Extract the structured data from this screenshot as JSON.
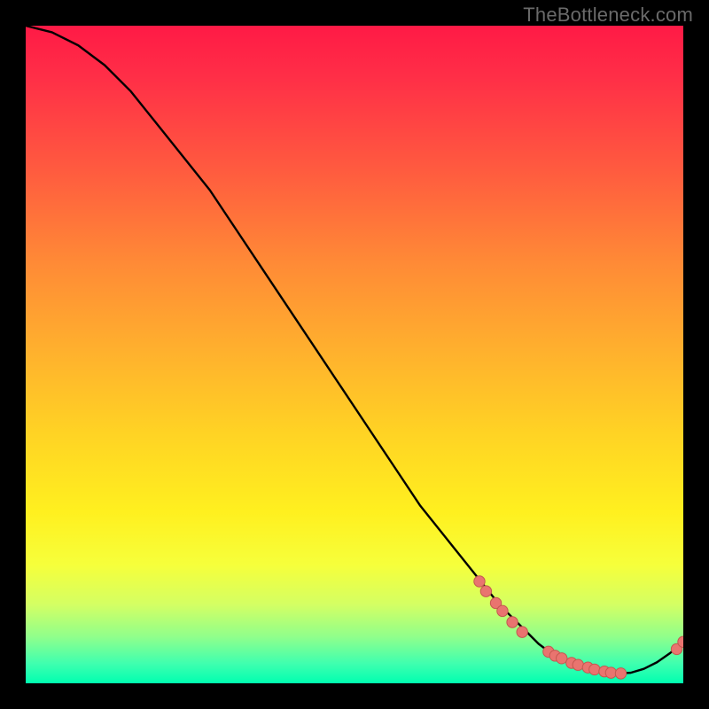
{
  "watermark": "TheBottleneck.com",
  "colors": {
    "background": "#000000",
    "curve": "#000000",
    "marker_fill": "#e9746f",
    "marker_stroke": "#c45850"
  },
  "chart_data": {
    "type": "line",
    "title": "",
    "xlabel": "",
    "ylabel": "",
    "xlim": [
      0,
      100
    ],
    "ylim": [
      0,
      100
    ],
    "grid": false,
    "series": [
      {
        "name": "curve",
        "x": [
          0,
          4,
          8,
          12,
          16,
          20,
          24,
          28,
          32,
          36,
          40,
          44,
          48,
          52,
          56,
          60,
          64,
          68,
          72,
          74,
          76,
          78,
          80,
          82,
          84,
          86,
          88,
          90,
          92,
          94,
          96,
          98,
          100
        ],
        "y": [
          100,
          99,
          97,
          94,
          90,
          85,
          80,
          75,
          69,
          63,
          57,
          51,
          45,
          39,
          33,
          27,
          22,
          17,
          12,
          10,
          8,
          6,
          4.5,
          3.5,
          2.7,
          2.1,
          1.7,
          1.5,
          1.6,
          2.2,
          3.2,
          4.6,
          6.3
        ]
      }
    ],
    "markers": [
      {
        "x": 69.0,
        "y": 15.5
      },
      {
        "x": 70.0,
        "y": 14.0
      },
      {
        "x": 71.5,
        "y": 12.2
      },
      {
        "x": 72.5,
        "y": 11.0
      },
      {
        "x": 74.0,
        "y": 9.3
      },
      {
        "x": 75.5,
        "y": 7.8
      },
      {
        "x": 79.5,
        "y": 4.8
      },
      {
        "x": 80.5,
        "y": 4.2
      },
      {
        "x": 81.5,
        "y": 3.8
      },
      {
        "x": 83.0,
        "y": 3.1
      },
      {
        "x": 84.0,
        "y": 2.8
      },
      {
        "x": 85.5,
        "y": 2.4
      },
      {
        "x": 86.5,
        "y": 2.1
      },
      {
        "x": 88.0,
        "y": 1.8
      },
      {
        "x": 89.0,
        "y": 1.6
      },
      {
        "x": 90.5,
        "y": 1.5
      },
      {
        "x": 99.0,
        "y": 5.2
      },
      {
        "x": 100.0,
        "y": 6.3
      }
    ]
  }
}
